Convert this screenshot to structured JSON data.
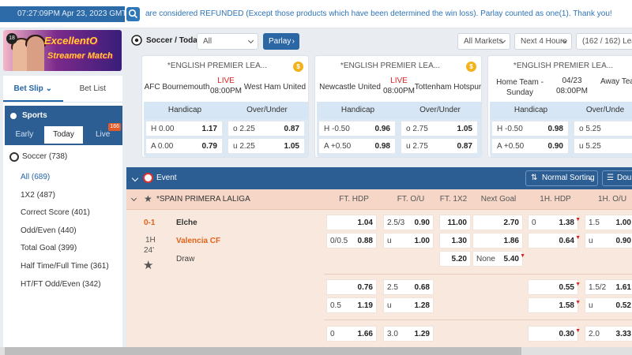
{
  "header": {
    "datetime": "07:27:09PM Apr 23, 2023 GMT +7",
    "ticker": "are considered REFUNDED (Except those products which have been determined the win loss). Parlay counted as one(1). Thank you!"
  },
  "banner": {
    "line1": "ExcellentO",
    "line2": "Streamer Match",
    "badge": "18"
  },
  "sidebar": {
    "tabs": [
      "Bet Slip",
      "Bet List"
    ],
    "sports_title": "Sports",
    "sport_tabs": [
      "Early",
      "Today",
      "Live"
    ],
    "live_count": "166",
    "soccer": "Soccer (738)",
    "bet_types": [
      "All (689)",
      "1X2 (487)",
      "Correct Score (401)",
      "Odd/Even (440)",
      "Total Goal (399)",
      "Half Time/Full Time (361)",
      "HT/FT Odd/Even (342)"
    ]
  },
  "filter": {
    "title": "Soccer / Today",
    "sport_select": "All",
    "parlay": "Parlay",
    "markets": "All Markets",
    "hours": "Next 4 Hours",
    "league_count": "(162 / 162) Leagu"
  },
  "cards": [
    {
      "league": "*ENGLISH PREMIER LEA...",
      "home": "AFC Bournemouth",
      "away": "West Ham United",
      "status": "LIVE",
      "time": "08:00PM",
      "h_label": "Handicap",
      "ou_label": "Over/Under",
      "rows": [
        {
          "hl": "H 0.00",
          "ho": "1.17",
          "ol": "o 2.25",
          "oo": "0.87"
        },
        {
          "hl": "A 0.00",
          "ho": "0.79",
          "ol": "u 2.25",
          "oo": "1.05"
        }
      ]
    },
    {
      "league": "*ENGLISH PREMIER LEA...",
      "home": "Newcastle United",
      "away": "Tottenham Hotspur",
      "status": "LIVE",
      "time": "08:00PM",
      "h_label": "Handicap",
      "ou_label": "Over/Under",
      "rows": [
        {
          "hl": "H -0.50",
          "ho": "0.96",
          "ol": "o 2.75",
          "oo": "1.05"
        },
        {
          "hl": "A +0.50",
          "ho": "0.98",
          "ol": "u 2.75",
          "oo": "0.87"
        }
      ]
    },
    {
      "league": "*ENGLISH PREMIER LEA...",
      "home": "Home Team - Sunday",
      "away": "Away Tea",
      "status": "04/23",
      "time": "08:00PM",
      "h_label": "Handicap",
      "ou_label": "Over/Unde",
      "rows": [
        {
          "hl": "H -0.50",
          "ho": "0.98",
          "ol": "o 5.25",
          "oo": ""
        },
        {
          "hl": "A +0.50",
          "ho": "0.90",
          "ol": "u 5.25",
          "oo": ""
        }
      ]
    }
  ],
  "event": {
    "label": "Event",
    "sort": "Normal Sorting",
    "double": "Doub"
  },
  "league": {
    "name": "*SPAIN PRIMERA LALIGA",
    "columns": [
      "FT. HDP",
      "FT. O/U",
      "FT. 1X2",
      "Next Goal",
      "1H. HDP",
      "1H. O/U"
    ]
  },
  "match": {
    "score": "0-1",
    "half": "1H",
    "minute": "24'",
    "home": "Elche",
    "away": "Valencia CF",
    "draw": "Draw",
    "odds": {
      "hdp1_h": "1.04",
      "hdp1_l": "0/0.5",
      "hdp1_a": "0.88",
      "ou1_l1": "2.5/3",
      "ou1_o1": "0.90",
      "ou1_l2": "u",
      "ou1_o2": "1.00",
      "x1": "11.00",
      "x2": "1.30",
      "x3": "5.20",
      "ng1": "2.70",
      "ng2": "1.86",
      "ng3_l": "None",
      "ng3": "5.40",
      "h1_l": "0",
      "h1_o1": "1.38",
      "h1_o2": "0.64",
      "h1ou_l1": "1.5",
      "h1ou_o1": "1.00",
      "h1ou_l2": "u",
      "h1ou_o2": "0.90",
      "r2_hdp1": "0.76",
      "r2_ou_l": "2.5",
      "r2_ou1": "0.68",
      "r2_hdp_l": "0.5",
      "r2_hdp2": "1.19",
      "r2_ou_l2": "u",
      "r2_ou2": "1.28",
      "r2_h1_1": "0.55",
      "r2_h1ou_l": "1.5/2",
      "r2_h1ou1": "1.61",
      "r2_h1_2": "1.58",
      "r2_h1ou_l2": "u",
      "r2_h1ou2": "0.52",
      "r3_hdp_l": "0",
      "r3_hdp": "1.66",
      "r3_ou_l": "3.0",
      "r3_ou": "1.29",
      "r3_h1": "0.30",
      "r3_h1ou_l": "2.0",
      "r3_h1ou": "3.33"
    }
  }
}
